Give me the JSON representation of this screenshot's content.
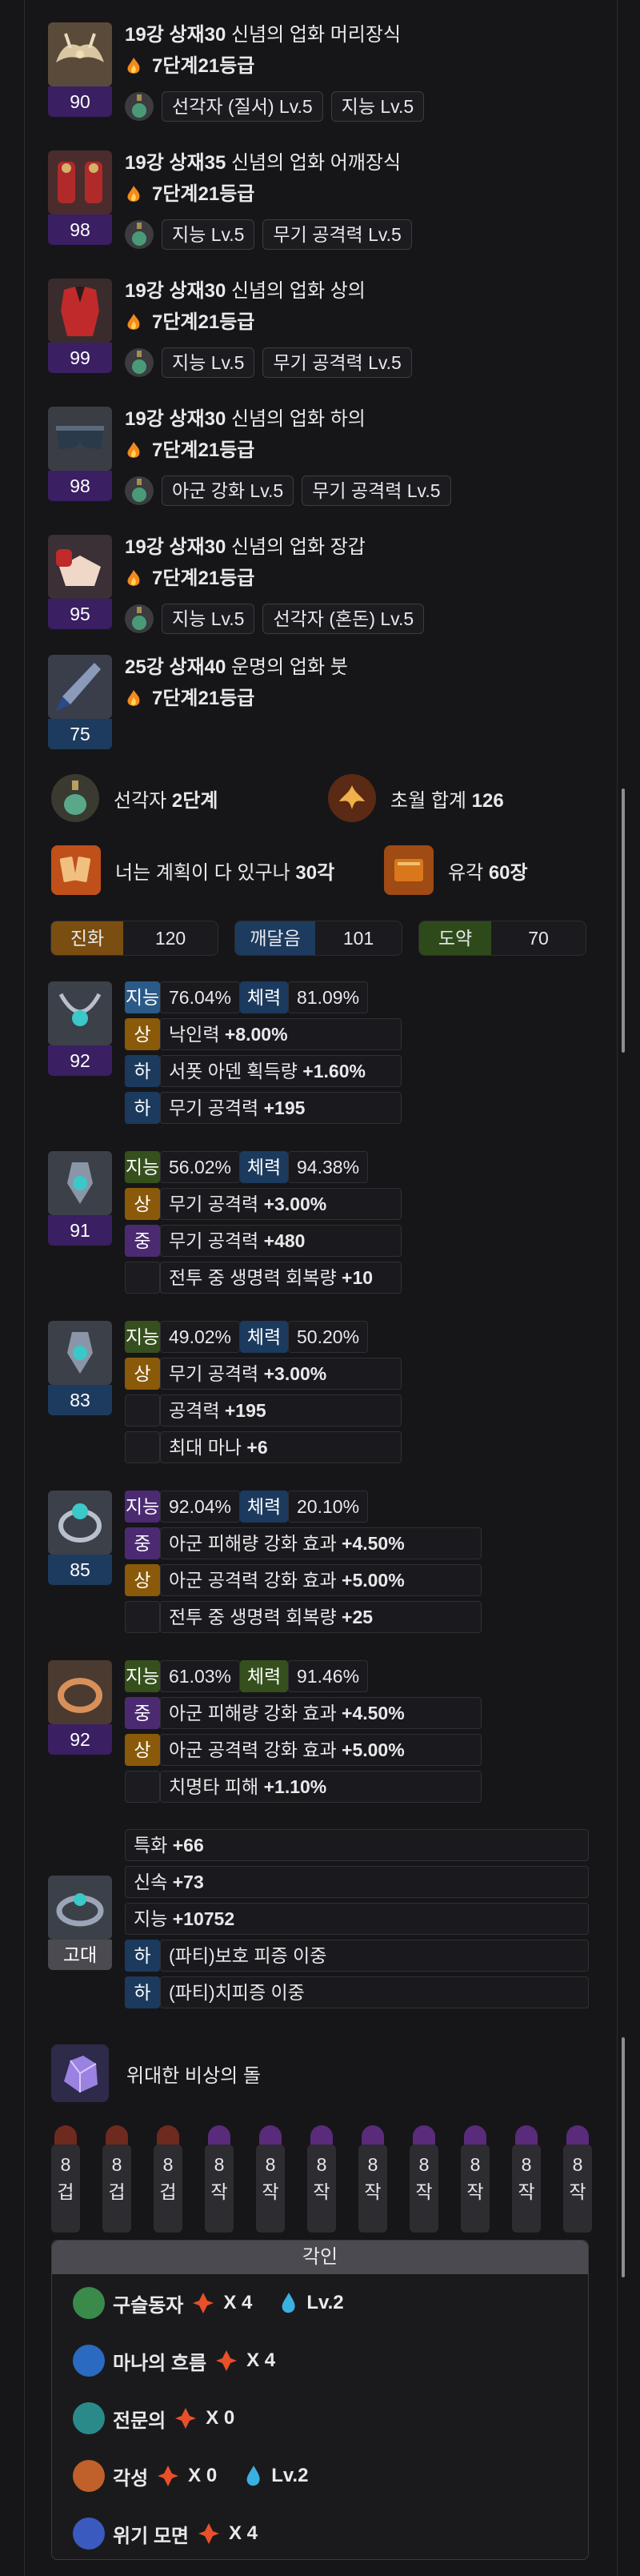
{
  "equipment": [
    {
      "title": "19강 상재30 신념의 업화 머리장식",
      "title_parts": [
        "19강 상재",
        "30",
        " 신념의 업화 머리장식"
      ],
      "tier_prefix": "7단계 ",
      "tier_num": "21",
      "tier_suffix": "등급",
      "quality": "90",
      "opts": [
        "선각자 (질서) Lv.5",
        "지능 Lv.5"
      ]
    },
    {
      "title": "19강 상재35 신념의 업화 어깨장식",
      "title_parts": [
        "19강 상재",
        "35",
        " 신념의 업화 어깨장식"
      ],
      "tier_prefix": "7단계 ",
      "tier_num": "21",
      "tier_suffix": "등급",
      "quality": "98",
      "opts": [
        "지능 Lv.5",
        "무기 공격력 Lv.5"
      ]
    },
    {
      "title": "19강 상재30 신념의 업화 상의",
      "title_parts": [
        "19강 상재",
        "30",
        " 신념의 업화 상의"
      ],
      "tier_prefix": "7단계 ",
      "tier_num": "21",
      "tier_suffix": "등급",
      "quality": "99",
      "opts": [
        "지능 Lv.5",
        "무기 공격력 Lv.5"
      ]
    },
    {
      "title": "19강 상재30 신념의 업화 하의",
      "title_parts": [
        "19강 상재",
        "30",
        " 신념의 업화 하의"
      ],
      "tier_prefix": "7단계 ",
      "tier_num": "21",
      "tier_suffix": "등급",
      "quality": "98",
      "opts": [
        "아군 강화 Lv.5",
        "무기 공격력 Lv.5"
      ]
    },
    {
      "title": "19강 상재30 신념의 업화 장갑",
      "title_parts": [
        "19강 상재",
        "30",
        " 신념의 업화 장갑"
      ],
      "tier_prefix": "7단계 ",
      "tier_num": "21",
      "tier_suffix": "등급",
      "quality": "95",
      "opts": [
        "지능 Lv.5",
        "선각자 (혼돈) Lv.5"
      ]
    },
    {
      "title": "25강 상재40 운명의 업화 붓",
      "title_parts": [
        "25강 상재",
        "40",
        " 운명의 업화 붓"
      ],
      "tier_prefix": "7단계 ",
      "tier_num": "21",
      "tier_suffix": "등급",
      "quality": "75",
      "opts": []
    }
  ],
  "summary": {
    "ark_passive": {
      "label": "선각자 ",
      "value": "2단계"
    },
    "transcend": {
      "label": "초월 합계 ",
      "value": "126"
    },
    "card": {
      "label": "너는 계획이 다 있구나 ",
      "value": "30각"
    },
    "relic": {
      "label": "유각 ",
      "value": "60장"
    }
  },
  "ark_tabs": [
    {
      "name": "진화",
      "value": "120",
      "color": "#7a4d10"
    },
    {
      "name": "깨달음",
      "value": "101",
      "color": "#1d3b5e"
    },
    {
      "name": "도약",
      "value": "70",
      "color": "#2e4a1a"
    }
  ],
  "accessories": [
    {
      "quality": "92",
      "rows": [
        {
          "tag": "지능",
          "pct": "76.04%",
          "tag2": "체력",
          "pct2": "81.09%"
        },
        {
          "grade": "상",
          "text": "낙인력 ",
          "bold": "+8.00%"
        },
        {
          "grade": "하",
          "text": "서폿 아덴 획득량 ",
          "bold": "+1.60%"
        },
        {
          "grade": "하",
          "text": "무기 공격력 ",
          "bold": "+195"
        }
      ]
    },
    {
      "quality": "91",
      "rows": [
        {
          "tag": "지능",
          "pct": "56.02%",
          "tag2": "체력",
          "pct2": "94.38%"
        },
        {
          "grade": "상",
          "text": "무기 공격력 ",
          "bold": "+3.00%"
        },
        {
          "grade": "중",
          "text": "무기 공격력 ",
          "bold": "+480"
        },
        {
          "grade": "",
          "text": "전투 중 생명력 회복량 ",
          "bold": "+10"
        }
      ]
    },
    {
      "quality": "83",
      "rows": [
        {
          "tag": "지능",
          "pct": "49.02%",
          "tag2": "체력",
          "pct2": "50.20%"
        },
        {
          "grade": "상",
          "text": "무기 공격력 ",
          "bold": "+3.00%"
        },
        {
          "grade": "",
          "text": "공격력 ",
          "bold": "+195"
        },
        {
          "grade": "",
          "text": "최대 마나 ",
          "bold": "+6"
        }
      ]
    },
    {
      "quality": "85",
      "rows": [
        {
          "tag": "지능",
          "pct": "92.04%",
          "tag2": "체력",
          "pct2": "20.10%"
        },
        {
          "grade": "중",
          "text": "아군 피해량 강화 효과 ",
          "bold": "+4.50%"
        },
        {
          "grade": "상",
          "text": "아군 공격력 강화 효과 ",
          "bold": "+5.00%"
        },
        {
          "grade": "",
          "text": "전투 중 생명력 회복량 ",
          "bold": "+25"
        }
      ]
    },
    {
      "quality": "92",
      "rows": [
        {
          "tag": "지능",
          "pct": "61.03%",
          "tag2": "체력",
          "pct2": "91.46%"
        },
        {
          "grade": "중",
          "text": "아군 피해량 강화 효과 ",
          "bold": "+4.50%"
        },
        {
          "grade": "상",
          "text": "아군 공격력 강화 효과 ",
          "bold": "+5.00%"
        },
        {
          "grade": "",
          "text": "치명타 피해 ",
          "bold": "+1.10%"
        }
      ]
    }
  ],
  "bracelet": {
    "quality": "고대",
    "rows": [
      {
        "grade": "",
        "text": "특화 ",
        "bold": "+66"
      },
      {
        "grade": "",
        "text": "신속 ",
        "bold": "+73"
      },
      {
        "grade": "",
        "text": "지능 ",
        "bold": "+10752"
      },
      {
        "grade": "하",
        "text": "(파티)보호 피증 이중",
        "bold": ""
      },
      {
        "grade": "하",
        "text": "(파티)치피증 이중",
        "bold": ""
      }
    ]
  },
  "stone": {
    "name": "위대한 비상의 돌"
  },
  "gems": [
    {
      "lv": "8",
      "type": "겁"
    },
    {
      "lv": "8",
      "type": "겁"
    },
    {
      "lv": "8",
      "type": "겁"
    },
    {
      "lv": "8",
      "type": "작"
    },
    {
      "lv": "8",
      "type": "작"
    },
    {
      "lv": "8",
      "type": "작"
    },
    {
      "lv": "8",
      "type": "작"
    },
    {
      "lv": "8",
      "type": "작"
    },
    {
      "lv": "8",
      "type": "작"
    },
    {
      "lv": "8",
      "type": "작"
    },
    {
      "lv": "8",
      "type": "작"
    }
  ],
  "engravings": {
    "title": "각인",
    "rows": [
      {
        "name": "구슬동자",
        "count": "X 4",
        "stone": "Lv.2"
      },
      {
        "name": "마나의 흐름",
        "count": "X 4",
        "stone": ""
      },
      {
        "name": "전문의",
        "count": "X 0",
        "stone": ""
      },
      {
        "name": "각성",
        "count": "X 0",
        "stone": "Lv.2"
      },
      {
        "name": "위기 모면",
        "count": "X 4",
        "stone": ""
      }
    ]
  }
}
